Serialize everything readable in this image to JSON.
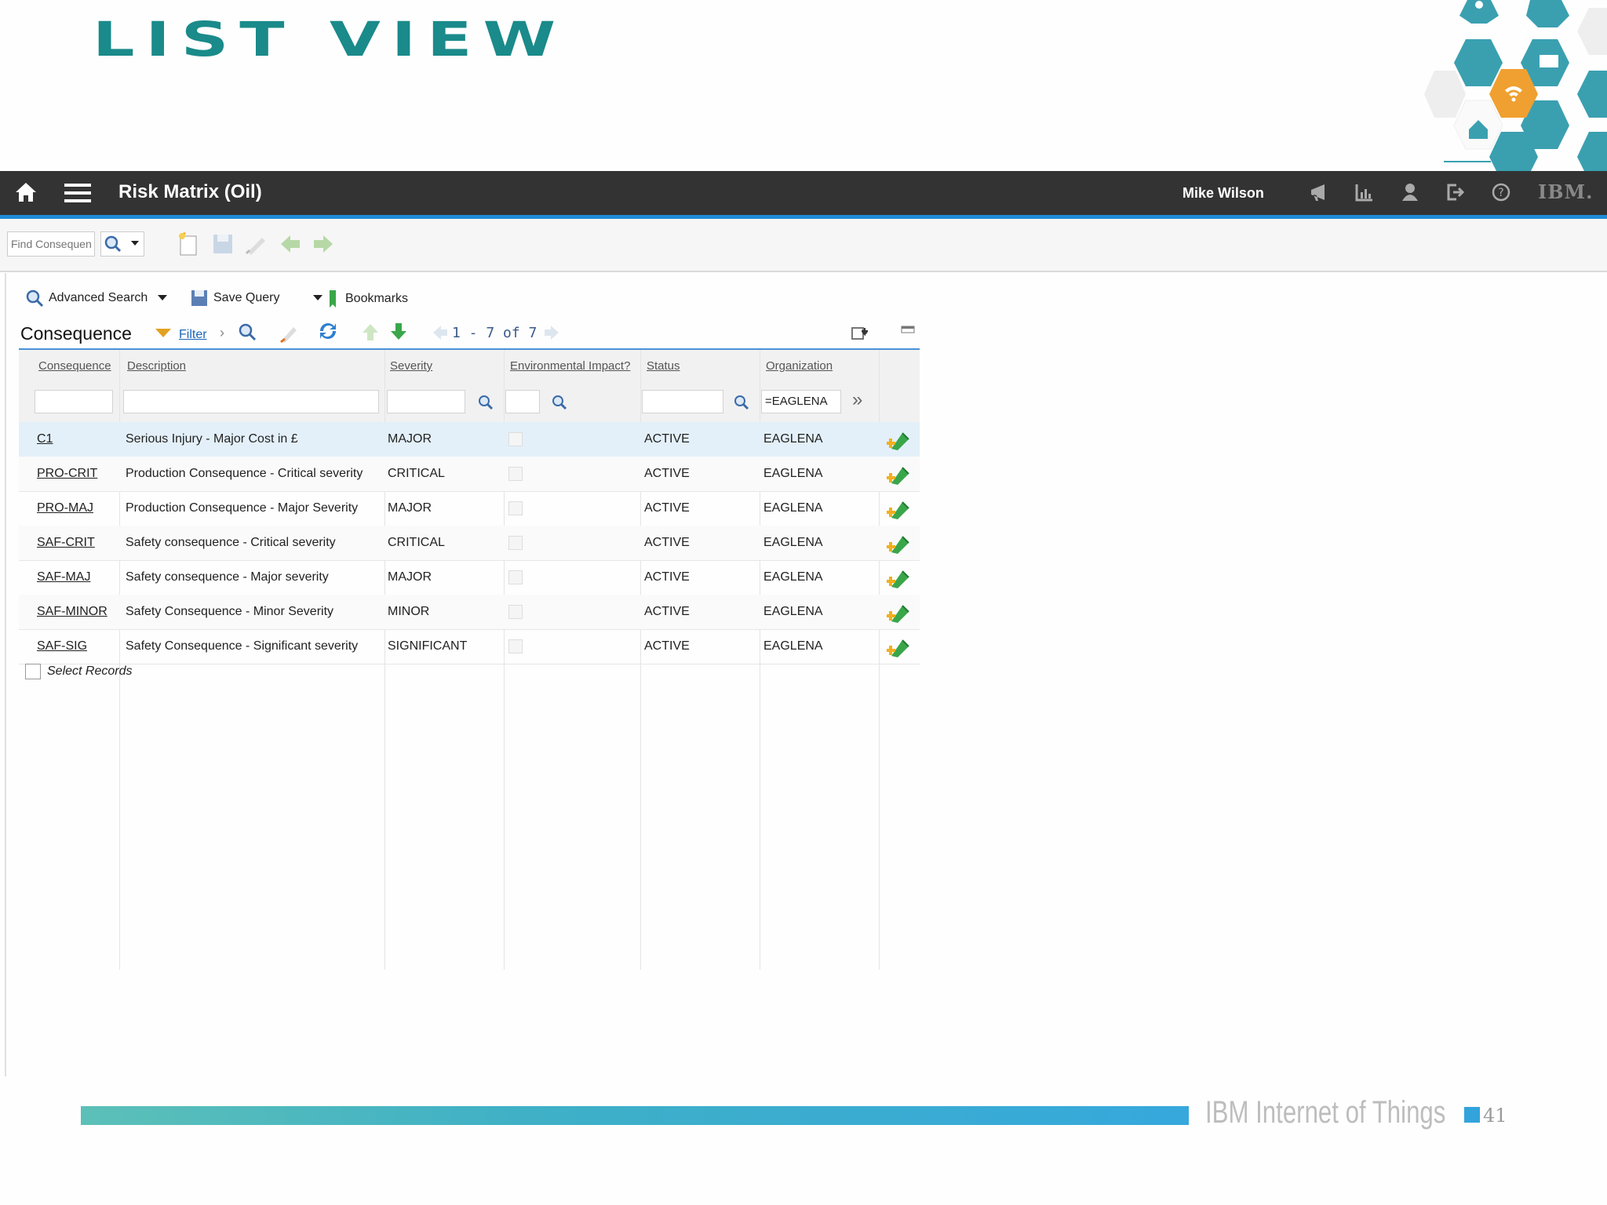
{
  "slide": {
    "title": "LIST VIEW",
    "footer_brand": "IBM Internet of Things",
    "page_number": "41"
  },
  "header": {
    "app_title": "Risk Matrix (Oil)",
    "user": "Mike Wilson",
    "brand": "IBM."
  },
  "toolbar": {
    "find_placeholder": "Find Consequence"
  },
  "query_bar": {
    "advanced_search": "Advanced Search",
    "save_query": "Save Query",
    "bookmarks": "Bookmarks"
  },
  "section": {
    "title": "Consequence",
    "filter_label": "Filter",
    "pager": "1 - 7 of 7"
  },
  "table": {
    "columns": [
      "Consequence",
      "Description",
      "Severity",
      "Environmental Impact?",
      "Status",
      "Organization"
    ],
    "filter_values": {
      "organization": "=EAGLENA"
    },
    "rows": [
      {
        "consequence": "C1",
        "description": "Serious Injury - Major Cost in £",
        "severity": "MAJOR",
        "status": "ACTIVE",
        "organization": "EAGLENA"
      },
      {
        "consequence": "PRO-CRIT",
        "description": "Production Consequence - Critical severity",
        "severity": "CRITICAL",
        "status": "ACTIVE",
        "organization": "EAGLENA"
      },
      {
        "consequence": "PRO-MAJ",
        "description": "Production Consequence - Major Severity",
        "severity": "MAJOR",
        "status": "ACTIVE",
        "organization": "EAGLENA"
      },
      {
        "consequence": "SAF-CRIT",
        "description": "Safety consequence - Critical severity",
        "severity": "CRITICAL",
        "status": "ACTIVE",
        "organization": "EAGLENA"
      },
      {
        "consequence": "SAF-MAJ",
        "description": "Safety consequence - Major severity",
        "severity": "MAJOR",
        "status": "ACTIVE",
        "organization": "EAGLENA"
      },
      {
        "consequence": "SAF-MINOR",
        "description": "Safety Consequence - Minor Severity",
        "severity": "MINOR",
        "status": "ACTIVE",
        "organization": "EAGLENA"
      },
      {
        "consequence": "SAF-SIG",
        "description": "Safety Consequence - Significant severity",
        "severity": "SIGNIFICANT",
        "status": "ACTIVE",
        "organization": "EAGLENA"
      }
    ]
  },
  "select_records_label": "Select Records",
  "colors": {
    "header_bg": "#333333",
    "accent": "#1d8bd6",
    "title_teal": "#1a8a8a",
    "selected_row": "#e3f0f9"
  }
}
